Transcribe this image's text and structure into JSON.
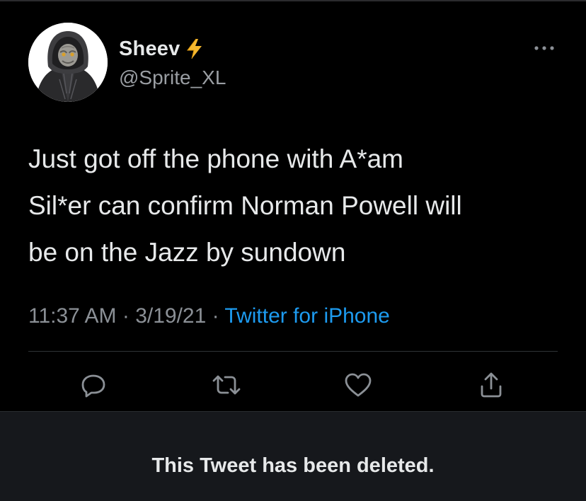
{
  "tweet": {
    "display_name": "Sheev",
    "name_emoji": "lightning-bolt-icon",
    "handle": "@Sprite_XL",
    "more_icon": "more-dots-icon",
    "avatar_icon": "emperor-lego-figure-avatar",
    "text": "Just got off the phone with A*am\nSil*er can confirm Norman Powell will\nbe on the Jazz by sundown",
    "time": "11:37 AM",
    "separator": " · ",
    "date": "3/19/21",
    "source": "Twitter for iPhone"
  },
  "actions": [
    {
      "icon": "reply-icon"
    },
    {
      "icon": "retweet-icon"
    },
    {
      "icon": "like-icon"
    },
    {
      "icon": "share-icon"
    }
  ],
  "deleted_notice": "This Tweet has been deleted.",
  "colors": {
    "background": "#000000",
    "text": "#e7e9ea",
    "muted": "#8b9096",
    "link": "#1d9bf0",
    "bolt": "#f5b82e",
    "deleted_panel": "#16181c"
  }
}
